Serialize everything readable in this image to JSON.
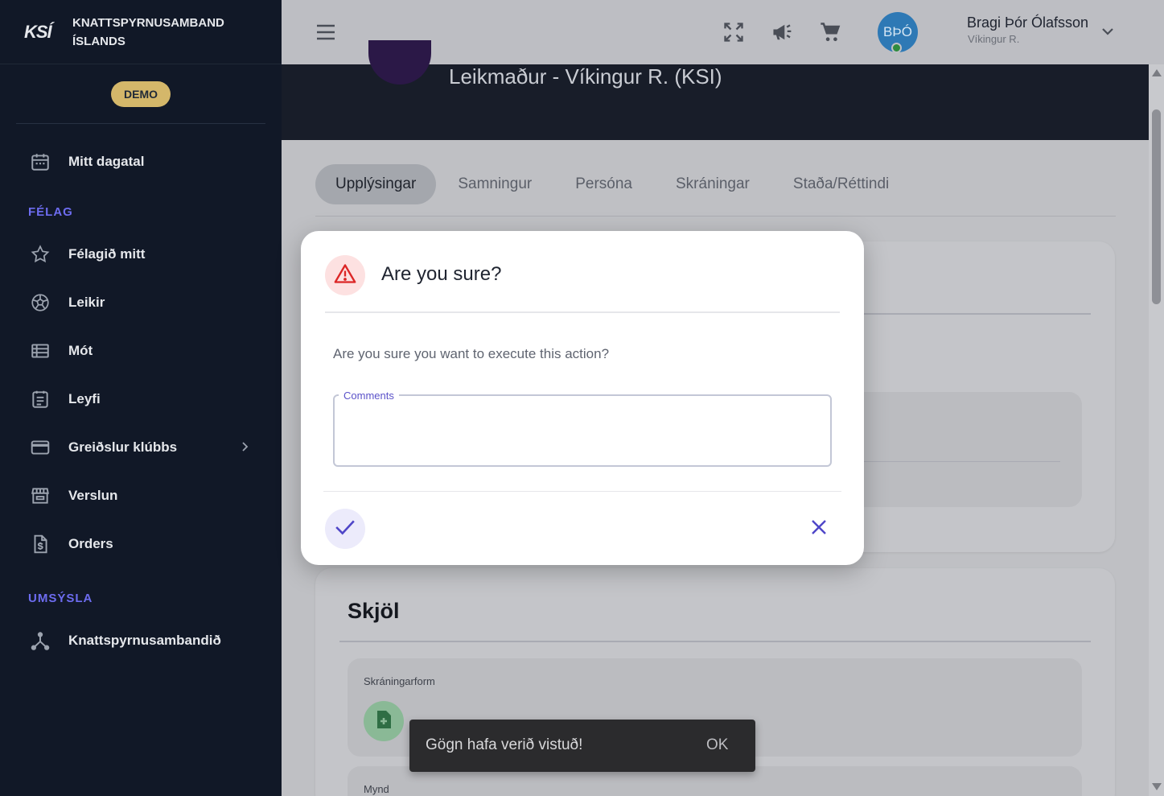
{
  "brand": {
    "logo_text": "KSÍ",
    "name_line1": "KNATTSPYRNUSAMBAND",
    "name_line2": "ÍSLANDS",
    "demo_badge": "DEMO"
  },
  "sidebar": {
    "top_item": {
      "label": "Mitt dagatal",
      "icon": "calendar-icon"
    },
    "section_felag": "FÉLAG",
    "felag_items": [
      {
        "label": "Félagið mitt",
        "icon": "star-icon"
      },
      {
        "label": "Leikir",
        "icon": "soccer-ball-icon"
      },
      {
        "label": "Mót",
        "icon": "list-table-icon"
      },
      {
        "label": "Leyfi",
        "icon": "document-list-icon"
      },
      {
        "label": "Greiðslur klúbbs",
        "icon": "credit-card-icon"
      },
      {
        "label": "Verslun",
        "icon": "store-icon"
      },
      {
        "label": "Orders",
        "icon": "invoice-icon"
      }
    ],
    "section_umsysla": "UMSÝSLA",
    "umsysla_items": [
      {
        "label": "Knattspyrnusambandið",
        "icon": "hierarchy-icon"
      }
    ]
  },
  "topbar": {
    "avatar_initials": "BÞÓ",
    "user_name": "Bragi Þór Ólafsson",
    "user_club": "Víkingur R."
  },
  "hero": {
    "title": "Leikmaður - Víkingur R. (KSI)"
  },
  "tabs": [
    {
      "label": "Upplýsingar",
      "active": true
    },
    {
      "label": "Samningur",
      "active": false
    },
    {
      "label": "Persóna",
      "active": false
    },
    {
      "label": "Skráningar",
      "active": false
    },
    {
      "label": "Staða/Réttindi",
      "active": false
    }
  ],
  "documents": {
    "title": "Skjöl",
    "field1_label": "Skráningarform",
    "field2_label": "Mynd"
  },
  "dialog": {
    "title": "Are you sure?",
    "message": "Are you sure you want to execute this action?",
    "comments_label": "Comments",
    "comments_value": ""
  },
  "snackbar": {
    "message": "Gögn hafa verið vistuð!",
    "action": "OK"
  },
  "colors": {
    "sidebar_bg": "#111827",
    "accent": "#5b52c9",
    "demo_badge": "#d4b76a",
    "warning": "#e53935",
    "snackbar_bg": "#2b2b2d"
  }
}
